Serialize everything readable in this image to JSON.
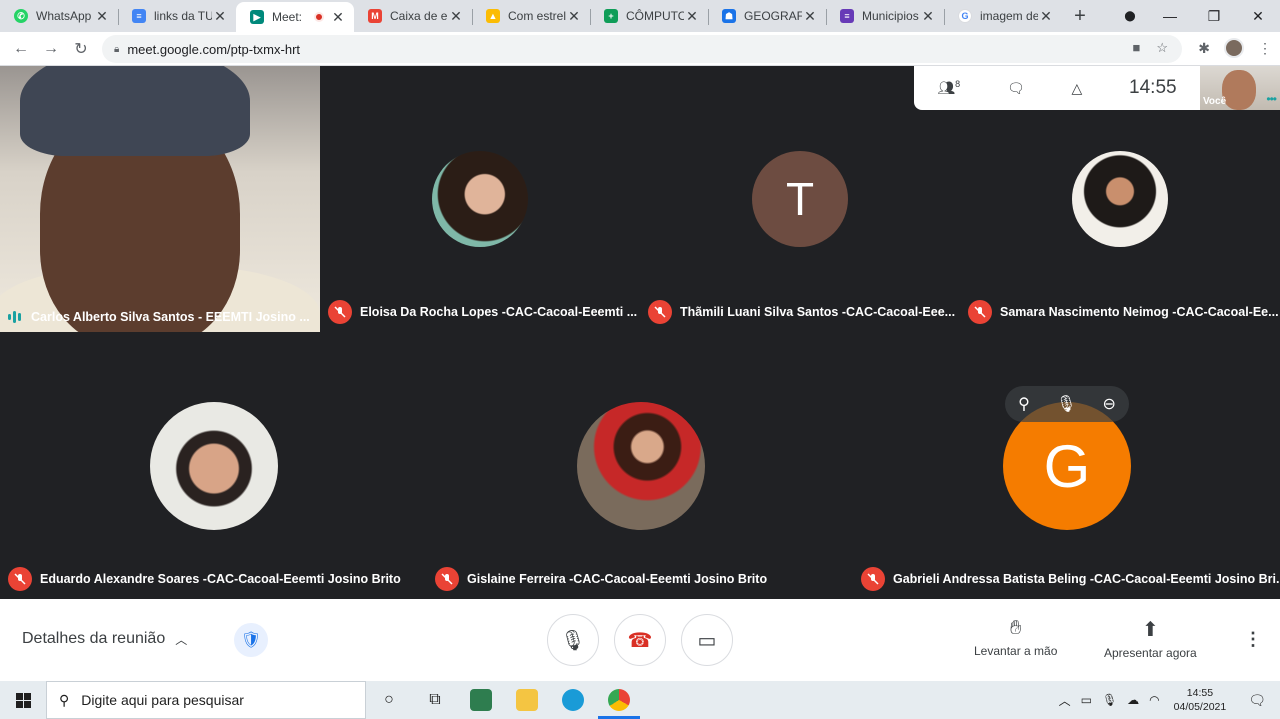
{
  "browser": {
    "tabs": [
      {
        "title": "WhatsApp",
        "favicon": "whatsapp-icon",
        "color": "#25d366"
      },
      {
        "title": "links da TU",
        "favicon": "docs-icon",
        "color": "#4285f4"
      },
      {
        "title": "Meet:",
        "favicon": "meet-icon",
        "color": "#00897b",
        "active": true,
        "recording": true
      },
      {
        "title": "Caixa de e",
        "favicon": "gmail-icon",
        "color": "#ea4335"
      },
      {
        "title": "Com estrel",
        "favicon": "drive-icon",
        "color": "#fbbc04"
      },
      {
        "title": "CÔMPUTO",
        "favicon": "sheets-icon",
        "color": "#0f9d58"
      },
      {
        "title": "GEOGRAFI",
        "favicon": "classroom-icon",
        "color": "#1a73e8"
      },
      {
        "title": "Municipios",
        "favicon": "forms-icon",
        "color": "#673ab7"
      },
      {
        "title": "imagem de",
        "favicon": "google-icon",
        "color": "#4285f4"
      }
    ],
    "url": "meet.google.com/ptp-txmx-hrt"
  },
  "meet": {
    "toolbar": {
      "participants_count": "8",
      "clock": "14:55"
    },
    "self_label": "Você",
    "tiles": [
      {
        "name": "Carlos Alberto Silva Santos - EEEMTI Josino ..."
      },
      {
        "name": "Eloisa Da Rocha Lopes -CAC-Cacoal-Eeemti ..."
      },
      {
        "name": "Thãmili Luani Silva Santos -CAC-Cacoal-Eee...",
        "initial": "T",
        "color": "#6d4c41"
      },
      {
        "name": "Samara Nascimento Neimog -CAC-Cacoal-Ee..."
      },
      {
        "name": "Eduardo Alexandre Soares -CAC-Cacoal-Eeemti Josino Brito"
      },
      {
        "name": "Gislaine Ferreira -CAC-Cacoal-Eeemti Josino Brito"
      },
      {
        "name": "Gabrieli Andressa Batista Beling -CAC-Cacoal-Eeemti Josino Bri...",
        "initial": "G",
        "color": "#f57c00"
      }
    ],
    "bottom": {
      "details_label": "Detalhes da reunião",
      "raise_hand": "Levantar a mão",
      "present_now": "Apresentar agora"
    }
  },
  "taskbar": {
    "search_placeholder": "Digite aqui para pesquisar",
    "time": "14:55",
    "date": "04/05/2021"
  }
}
